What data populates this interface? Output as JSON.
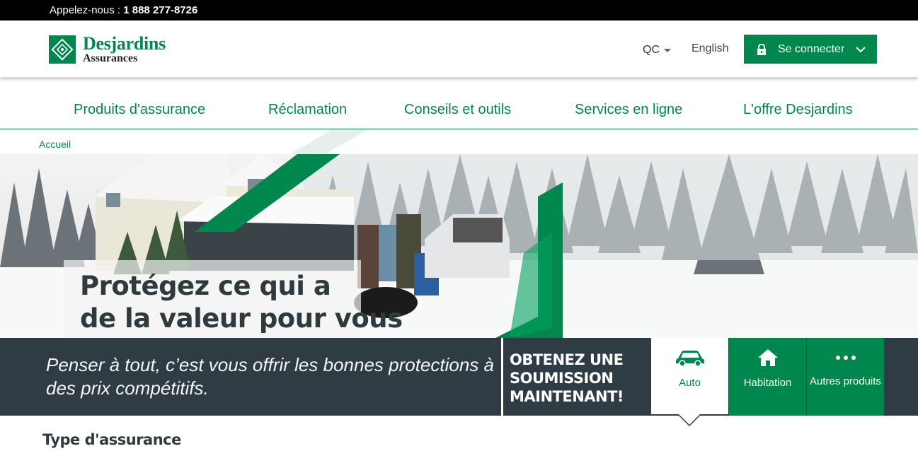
{
  "topbar": {
    "prefix": "Appelez-nous : ",
    "phone": "1 888 277-8726"
  },
  "header": {
    "logo_name": "Desjardins",
    "logo_sub": "Assurances",
    "region": "QC",
    "language": "English",
    "login_label": "Se connecter"
  },
  "nav": {
    "items": [
      {
        "label": "Produits d'assurance"
      },
      {
        "label": "Réclamation"
      },
      {
        "label": "Conseils et outils"
      },
      {
        "label": "Services en ligne"
      },
      {
        "label": "L'offre Desjardins"
      }
    ]
  },
  "breadcrumb": {
    "home": "Accueil"
  },
  "hero": {
    "line1": "Protégez ce qui a",
    "line2": "de la valeur pour vous"
  },
  "promo": {
    "tagline": "Penser à tout, c’est vous offrir les bonnes protections à des prix compétitifs.",
    "cta_line1": "OBTENEZ UNE",
    "cta_line2": "SOUMISSION",
    "cta_line3": "MAINTENANT!",
    "tiles": [
      {
        "label": "Auto",
        "icon": "car-icon",
        "selected": true
      },
      {
        "label": "Habitation",
        "icon": "house-icon",
        "selected": false
      },
      {
        "label": "Autres produits",
        "icon": "more-dots-icon",
        "selected": false
      }
    ]
  },
  "section": {
    "title": "Type d'assurance"
  },
  "colors": {
    "brand_green": "#00874e",
    "dark_panel": "#2f3c43",
    "topbar": "#000000"
  }
}
